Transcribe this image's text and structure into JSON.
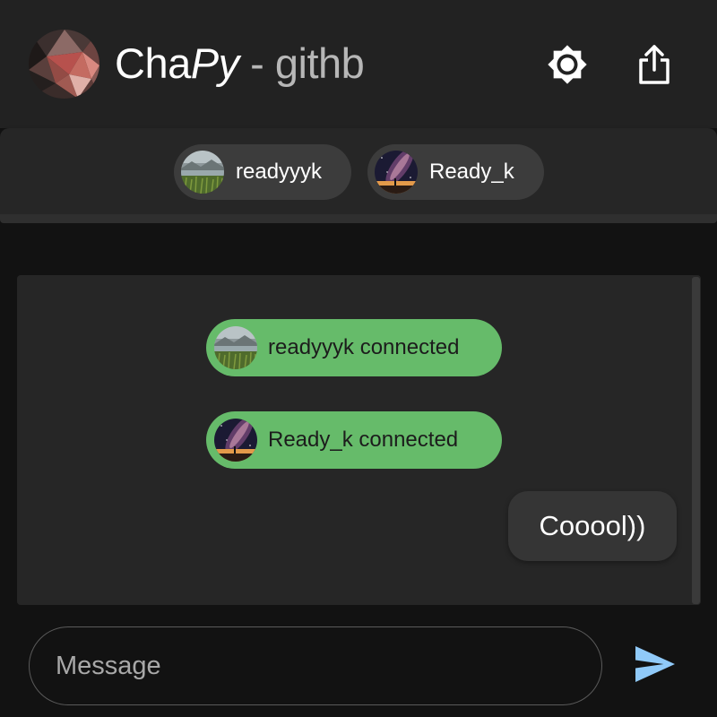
{
  "header": {
    "title_main": "Cha",
    "title_py": "Py",
    "title_sep": " - ",
    "title_repo": "githb",
    "logo_icon": "low-poly-portrait-logo",
    "theme_icon": "brightness-icon",
    "share_icon": "share-upload-icon"
  },
  "users": [
    {
      "name": "readyyyk",
      "avatar_icon": "lake-landscape-avatar"
    },
    {
      "name": "Ready_k",
      "avatar_icon": "milky-way-avatar"
    }
  ],
  "messages": {
    "notices": [
      {
        "text": "readyyyk connected",
        "avatar_icon": "lake-landscape-avatar"
      },
      {
        "text": "Ready_k connected",
        "avatar_icon": "milky-way-avatar"
      }
    ],
    "own": [
      {
        "text": "Cooool))"
      }
    ]
  },
  "composer": {
    "placeholder": "Message",
    "value": "",
    "send_icon": "send-icon"
  },
  "colors": {
    "header_bg": "#222222",
    "page_bg": "#121212",
    "chip_bg": "#3c3c3c",
    "notice_bg": "#66bb6a",
    "bubble_bg": "#353535",
    "send_accent": "#90caf9"
  }
}
